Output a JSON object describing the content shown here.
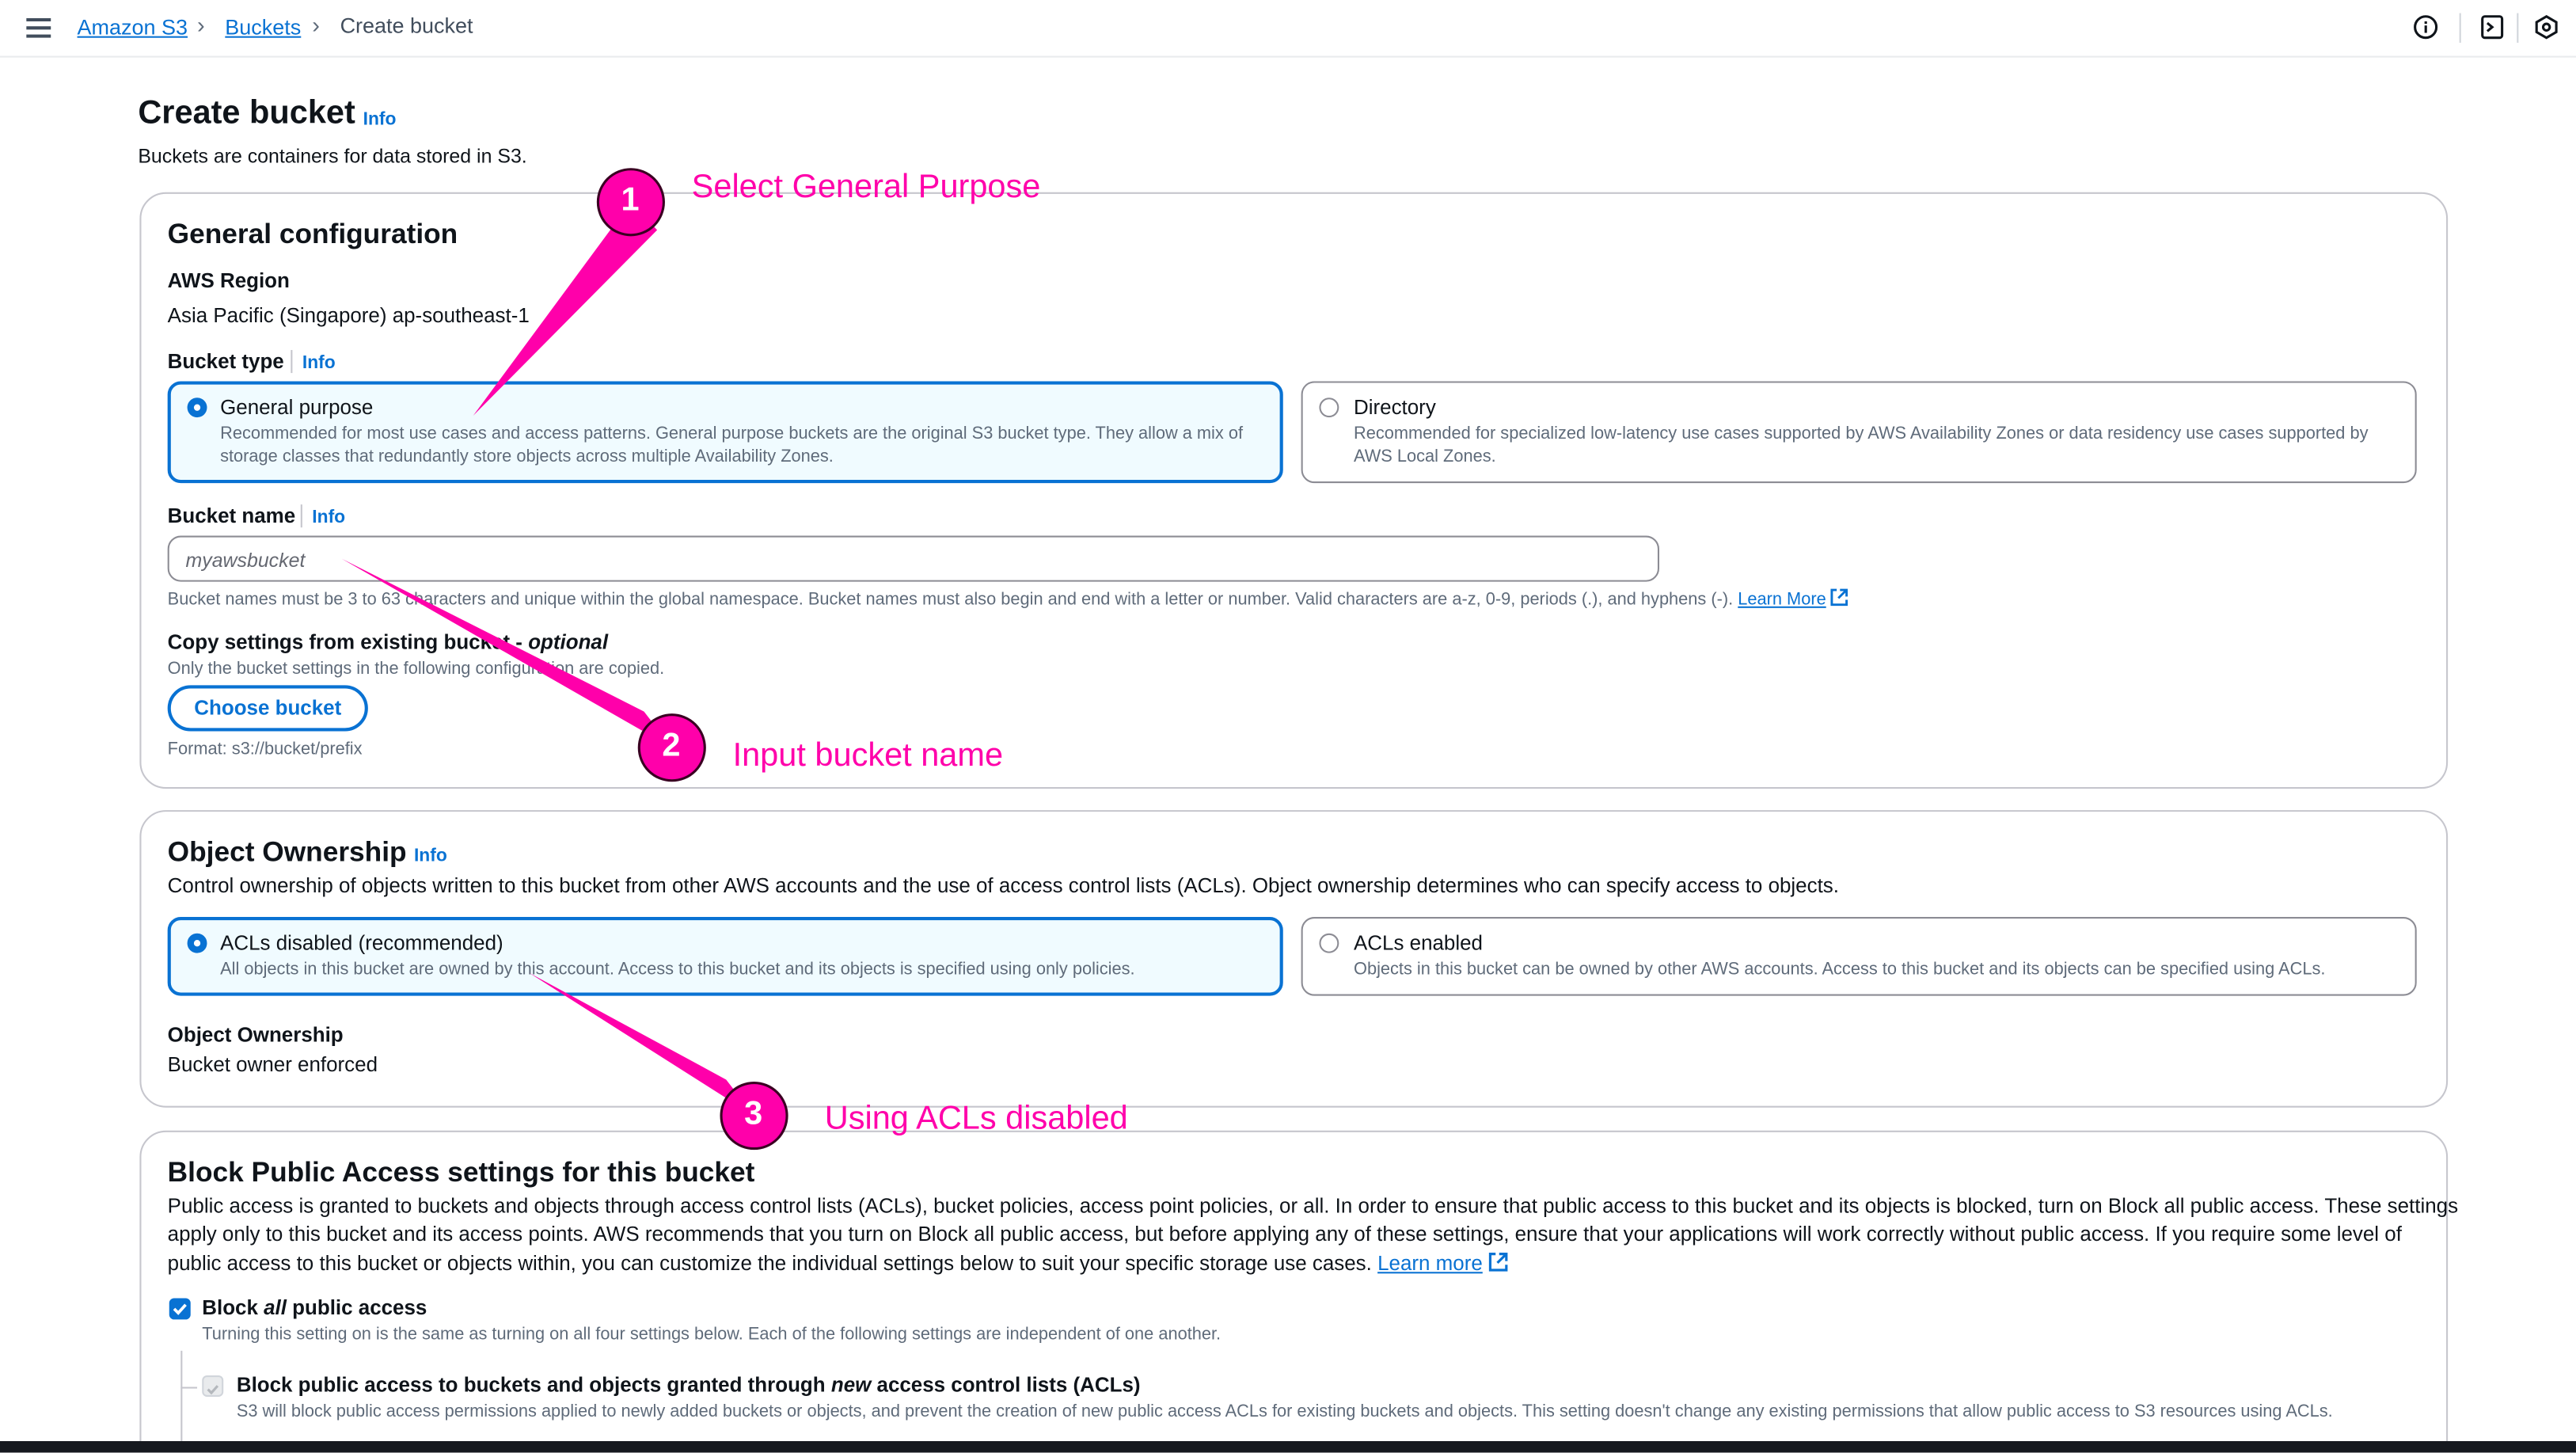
{
  "breadcrumb": {
    "root": "Amazon S3",
    "buckets": "Buckets",
    "current": "Create bucket"
  },
  "header": {
    "title": "Create bucket",
    "info": "Info",
    "subtitle": "Buckets are containers for data stored in S3."
  },
  "general": {
    "title": "General configuration",
    "region_label": "AWS Region",
    "region_value": "Asia Pacific (Singapore) ap-southeast-1",
    "bucket_type_label": "Bucket type",
    "info": "Info",
    "types": [
      {
        "title": "General purpose",
        "desc1": "Recommended for most use cases and access patterns. General purpose buckets are the original S3 bucket type. They allow a mix of",
        "desc2": "storage classes that redundantly store objects across multiple Availability Zones.",
        "selected": true
      },
      {
        "title": "Directory",
        "desc1": "Recommended for specialized low-latency use cases supported by AWS Availability Zones or data residency use cases supported by",
        "desc2": "AWS Local Zones.",
        "selected": false
      }
    ],
    "bucket_name_label": "Bucket name",
    "bucket_name_placeholder": "myawsbucket",
    "bucket_name_help": "Bucket names must be 3 to 63 characters and unique within the global namespace. Bucket names must also begin and end with a letter or number. Valid characters are a-z, 0-9, periods (.), and hyphens (-).",
    "learn_more": "Learn More",
    "copy_label": "Copy settings from existing bucket -",
    "copy_optional": "optional",
    "copy_desc": "Only the bucket settings in the following configuration are copied.",
    "choose_button": "Choose bucket",
    "format": "Format: s3://bucket/prefix"
  },
  "ownership": {
    "title": "Object Ownership",
    "info": "Info",
    "desc": "Control ownership of objects written to this bucket from other AWS accounts and the use of access control lists (ACLs). Object ownership determines who can specify access to objects.",
    "options": [
      {
        "title": "ACLs disabled (recommended)",
        "desc": "All objects in this bucket are owned by this account. Access to this bucket and its objects is specified using only policies.",
        "selected": true
      },
      {
        "title": "ACLs enabled",
        "desc": "Objects in this bucket can be owned by other AWS accounts. Access to this bucket and its objects can be specified using ACLs.",
        "selected": false
      }
    ],
    "label": "Object Ownership",
    "value": "Bucket owner enforced"
  },
  "block": {
    "title": "Block Public Access settings for this bucket",
    "p1": "Public access is granted to buckets and objects through access control lists (ACLs), bucket policies, access point policies, or all. In order to ensure that public access to this bucket and its objects is blocked, turn on Block all public access. These settings",
    "p2": "apply only to this bucket and its access points. AWS recommends that you turn on Block all public access, but before applying any of these settings, ensure that your applications will work correctly without public access. If you require some level of",
    "p3": "public access to this bucket or objects within, you can customize the individual settings below to suit your specific storage use cases.",
    "learn_more": "Learn more",
    "all_pre": "Block ",
    "all_em": "all",
    "all_post": " public access",
    "all_desc": "Turning this setting on is the same as turning on all four settings below. Each of the following settings are independent of one another.",
    "acl_pre": "Block public access to buckets and objects granted through ",
    "acl_em": "new",
    "acl_post": " access control lists (ACLs)",
    "acl_desc": "S3 will block public access permissions applied to newly added buckets or objects, and prevent the creation of new public access ACLs for existing buckets and objects. This setting doesn't change any existing permissions that allow public access to S3 resources using ACLs."
  },
  "annotations": [
    {
      "num": "1",
      "text": "Select General Purpose"
    },
    {
      "num": "2",
      "text": "Input bucket name"
    },
    {
      "num": "3",
      "text": "Using ACLs disabled"
    }
  ],
  "colors": {
    "accent": "#0972d3",
    "callout": "#ff00aa"
  }
}
